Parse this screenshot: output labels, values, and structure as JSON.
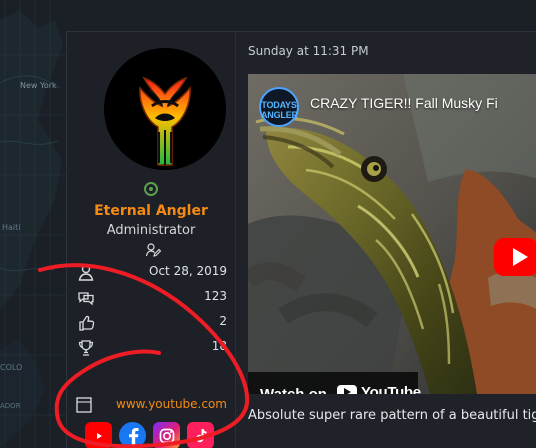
{
  "post": {
    "time": "Sunday at 11:31 PM",
    "text": "Absolute super rare pattern of a beautiful tiger"
  },
  "user": {
    "name": "Eternal Angler",
    "role": "Administrator",
    "online_icon": "online-status-icon",
    "role_icon": "user-edit-icon",
    "colors": {
      "name": "#f58a14",
      "online": "#5aa04f"
    }
  },
  "stats": [
    {
      "icon": "user-joined-icon",
      "value": "Oct 28, 2019"
    },
    {
      "icon": "messages-icon",
      "value": "123"
    },
    {
      "icon": "reaction-score-icon",
      "value": "2"
    },
    {
      "icon": "trophy-icon",
      "value": "18"
    }
  ],
  "website": {
    "icon": "website-icon",
    "label": "www.youtube.com"
  },
  "social": [
    {
      "name": "youtube",
      "icon": "youtube-icon",
      "color": "#ff0000"
    },
    {
      "name": "facebook",
      "icon": "facebook-icon",
      "color": "#1877f2"
    },
    {
      "name": "instagram",
      "icon": "instagram-icon",
      "color": "#c13584"
    },
    {
      "name": "tiktok",
      "icon": "tiktok-icon",
      "color": "#ff0050"
    }
  ],
  "video": {
    "title": "CRAZY TIGER!! Fall Musky Fi",
    "channel_badge": "TODAYS ANGLER",
    "watch_label": "Watch on",
    "youtube_label": "YouTube"
  }
}
